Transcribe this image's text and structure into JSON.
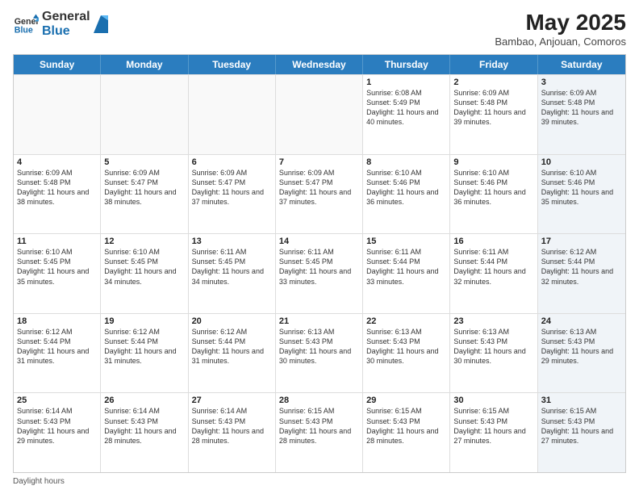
{
  "logo": {
    "general": "General",
    "blue": "Blue"
  },
  "header": {
    "month": "May 2025",
    "location": "Bambao, Anjouan, Comoros"
  },
  "weekdays": [
    "Sunday",
    "Monday",
    "Tuesday",
    "Wednesday",
    "Thursday",
    "Friday",
    "Saturday"
  ],
  "weeks": [
    [
      {
        "day": "",
        "info": "",
        "empty": true
      },
      {
        "day": "",
        "info": "",
        "empty": true
      },
      {
        "day": "",
        "info": "",
        "empty": true
      },
      {
        "day": "",
        "info": "",
        "empty": true
      },
      {
        "day": "1",
        "info": "Sunrise: 6:08 AM\nSunset: 5:49 PM\nDaylight: 11 hours and 40 minutes.",
        "empty": false
      },
      {
        "day": "2",
        "info": "Sunrise: 6:09 AM\nSunset: 5:48 PM\nDaylight: 11 hours and 39 minutes.",
        "empty": false
      },
      {
        "day": "3",
        "info": "Sunrise: 6:09 AM\nSunset: 5:48 PM\nDaylight: 11 hours and 39 minutes.",
        "empty": false,
        "shaded": true
      }
    ],
    [
      {
        "day": "4",
        "info": "Sunrise: 6:09 AM\nSunset: 5:48 PM\nDaylight: 11 hours and 38 minutes.",
        "empty": false
      },
      {
        "day": "5",
        "info": "Sunrise: 6:09 AM\nSunset: 5:47 PM\nDaylight: 11 hours and 38 minutes.",
        "empty": false
      },
      {
        "day": "6",
        "info": "Sunrise: 6:09 AM\nSunset: 5:47 PM\nDaylight: 11 hours and 37 minutes.",
        "empty": false
      },
      {
        "day": "7",
        "info": "Sunrise: 6:09 AM\nSunset: 5:47 PM\nDaylight: 11 hours and 37 minutes.",
        "empty": false
      },
      {
        "day": "8",
        "info": "Sunrise: 6:10 AM\nSunset: 5:46 PM\nDaylight: 11 hours and 36 minutes.",
        "empty": false
      },
      {
        "day": "9",
        "info": "Sunrise: 6:10 AM\nSunset: 5:46 PM\nDaylight: 11 hours and 36 minutes.",
        "empty": false
      },
      {
        "day": "10",
        "info": "Sunrise: 6:10 AM\nSunset: 5:46 PM\nDaylight: 11 hours and 35 minutes.",
        "empty": false,
        "shaded": true
      }
    ],
    [
      {
        "day": "11",
        "info": "Sunrise: 6:10 AM\nSunset: 5:45 PM\nDaylight: 11 hours and 35 minutes.",
        "empty": false
      },
      {
        "day": "12",
        "info": "Sunrise: 6:10 AM\nSunset: 5:45 PM\nDaylight: 11 hours and 34 minutes.",
        "empty": false
      },
      {
        "day": "13",
        "info": "Sunrise: 6:11 AM\nSunset: 5:45 PM\nDaylight: 11 hours and 34 minutes.",
        "empty": false
      },
      {
        "day": "14",
        "info": "Sunrise: 6:11 AM\nSunset: 5:45 PM\nDaylight: 11 hours and 33 minutes.",
        "empty": false
      },
      {
        "day": "15",
        "info": "Sunrise: 6:11 AM\nSunset: 5:44 PM\nDaylight: 11 hours and 33 minutes.",
        "empty": false
      },
      {
        "day": "16",
        "info": "Sunrise: 6:11 AM\nSunset: 5:44 PM\nDaylight: 11 hours and 32 minutes.",
        "empty": false
      },
      {
        "day": "17",
        "info": "Sunrise: 6:12 AM\nSunset: 5:44 PM\nDaylight: 11 hours and 32 minutes.",
        "empty": false,
        "shaded": true
      }
    ],
    [
      {
        "day": "18",
        "info": "Sunrise: 6:12 AM\nSunset: 5:44 PM\nDaylight: 11 hours and 31 minutes.",
        "empty": false
      },
      {
        "day": "19",
        "info": "Sunrise: 6:12 AM\nSunset: 5:44 PM\nDaylight: 11 hours and 31 minutes.",
        "empty": false
      },
      {
        "day": "20",
        "info": "Sunrise: 6:12 AM\nSunset: 5:44 PM\nDaylight: 11 hours and 31 minutes.",
        "empty": false
      },
      {
        "day": "21",
        "info": "Sunrise: 6:13 AM\nSunset: 5:43 PM\nDaylight: 11 hours and 30 minutes.",
        "empty": false
      },
      {
        "day": "22",
        "info": "Sunrise: 6:13 AM\nSunset: 5:43 PM\nDaylight: 11 hours and 30 minutes.",
        "empty": false
      },
      {
        "day": "23",
        "info": "Sunrise: 6:13 AM\nSunset: 5:43 PM\nDaylight: 11 hours and 30 minutes.",
        "empty": false
      },
      {
        "day": "24",
        "info": "Sunrise: 6:13 AM\nSunset: 5:43 PM\nDaylight: 11 hours and 29 minutes.",
        "empty": false,
        "shaded": true
      }
    ],
    [
      {
        "day": "25",
        "info": "Sunrise: 6:14 AM\nSunset: 5:43 PM\nDaylight: 11 hours and 29 minutes.",
        "empty": false
      },
      {
        "day": "26",
        "info": "Sunrise: 6:14 AM\nSunset: 5:43 PM\nDaylight: 11 hours and 28 minutes.",
        "empty": false
      },
      {
        "day": "27",
        "info": "Sunrise: 6:14 AM\nSunset: 5:43 PM\nDaylight: 11 hours and 28 minutes.",
        "empty": false
      },
      {
        "day": "28",
        "info": "Sunrise: 6:15 AM\nSunset: 5:43 PM\nDaylight: 11 hours and 28 minutes.",
        "empty": false
      },
      {
        "day": "29",
        "info": "Sunrise: 6:15 AM\nSunset: 5:43 PM\nDaylight: 11 hours and 28 minutes.",
        "empty": false
      },
      {
        "day": "30",
        "info": "Sunrise: 6:15 AM\nSunset: 5:43 PM\nDaylight: 11 hours and 27 minutes.",
        "empty": false
      },
      {
        "day": "31",
        "info": "Sunrise: 6:15 AM\nSunset: 5:43 PM\nDaylight: 11 hours and 27 minutes.",
        "empty": false,
        "shaded": true
      }
    ]
  ],
  "footer": {
    "label": "Daylight hours"
  }
}
